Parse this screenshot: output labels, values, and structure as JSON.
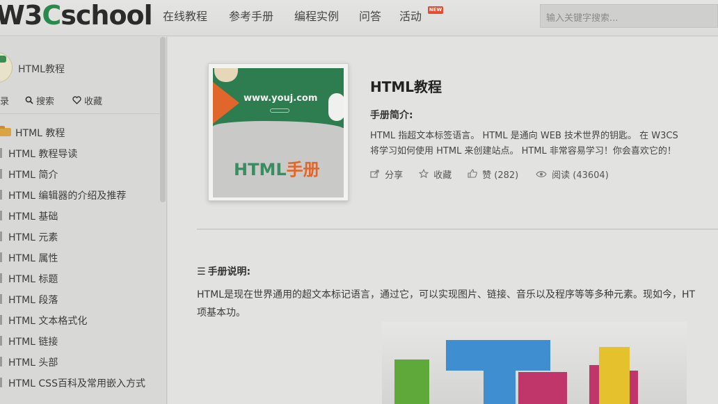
{
  "header": {
    "logo": {
      "part1": "W3",
      "part2": "C",
      "part3": "school"
    },
    "nav": [
      {
        "label": "在线教程"
      },
      {
        "label": "参考手册"
      },
      {
        "label": "编程实例"
      },
      {
        "label": "问答"
      },
      {
        "label": "活动"
      }
    ],
    "new_badge": "NEW",
    "search_placeholder": "输入关键字搜索..."
  },
  "sidebar": {
    "title": "HTML教程",
    "tools": [
      {
        "icon": "list-icon",
        "label": "录"
      },
      {
        "icon": "search-icon",
        "label": "搜索"
      },
      {
        "icon": "heart-icon",
        "label": "收藏"
      }
    ],
    "items": [
      {
        "label": "HTML 教程",
        "active": true
      },
      {
        "label": "HTML 教程导读"
      },
      {
        "label": "HTML 简介"
      },
      {
        "label": "HTML 编辑器的介绍及推荐"
      },
      {
        "label": "HTML 基础"
      },
      {
        "label": "HTML 元素"
      },
      {
        "label": "HTML 属性"
      },
      {
        "label": "HTML 标题"
      },
      {
        "label": "HTML 段落"
      },
      {
        "label": "HTML 文本格式化"
      },
      {
        "label": "HTML 链接"
      },
      {
        "label": "HTML 头部"
      },
      {
        "label": "HTML CSS百科及常用嵌入方式"
      }
    ]
  },
  "book": {
    "cover": {
      "url_text": "www.youj.com",
      "title_a": "HTML",
      "title_b": "手册"
    },
    "title": "HTML教程",
    "intro_label": "手册简介:",
    "intro_line1": "HTML 指超文本标签语言。 HTML 是通向 WEB 技术世界的钥匙。 在 W3CS",
    "intro_line2": "将学习如何使用 HTML 来创建站点。 HTML 非常容易学习！你会喜欢它的！",
    "actions": {
      "share": "分享",
      "favorite": "收藏",
      "like": "赞 (282)",
      "read": "阅读 (43604)"
    }
  },
  "description": {
    "label": "手册说明:",
    "line1": "HTML是现在世界通用的超文本标记语言，通过它，可以实现图片、链接、音乐以及程序等等多种元素。现如今，HT",
    "line2": "项基本功。"
  },
  "colors": {
    "brand_green": "#2a8a4e",
    "accent_orange": "#e0662c",
    "badge_red": "#e94b2f"
  }
}
